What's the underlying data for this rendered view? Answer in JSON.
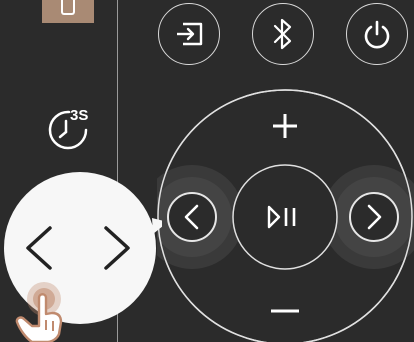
{
  "timer": {
    "label": "3S"
  },
  "colors": {
    "background": "#2b2b2b",
    "accent_tab": "#a98a74",
    "foreground": "#ffffff",
    "callout": "#f7f7f7",
    "hand": "#c08a6e"
  },
  "top_buttons": [
    {
      "name": "input-source",
      "icon": "input-icon"
    },
    {
      "name": "bluetooth",
      "icon": "bluetooth-icon"
    },
    {
      "name": "power",
      "icon": "power-icon"
    }
  ],
  "dial": {
    "up_icon": "plus-icon",
    "down_icon": "minus-icon",
    "left_icon": "chevron-left-icon",
    "right_icon": "chevron-right-icon",
    "center_icon": "play-pause-icon"
  },
  "callout": {
    "left_icon": "chevron-left-icon",
    "right_icon": "chevron-right-icon",
    "gesture_icon": "tap-hand-icon"
  }
}
